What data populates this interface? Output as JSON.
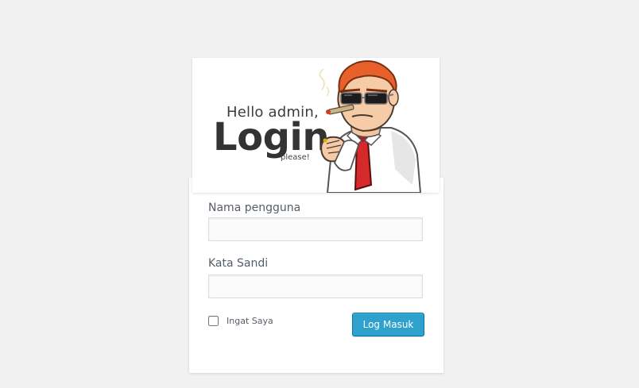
{
  "logo": {
    "hello_text": "Hello admin,",
    "login_text": "Login",
    "please_text": "please!",
    "mascot_icon": "mascot-bouncer-icon"
  },
  "form": {
    "username_label": "Nama pengguna",
    "username_value": "",
    "password_label": "Kata Sandi",
    "password_value": "",
    "remember_label": "Ingat Saya",
    "remember_checked": false,
    "submit_label": "Log Masuk"
  },
  "colors": {
    "background": "#f1f1f1",
    "card": "#ffffff",
    "button": "#2ea2cc",
    "button_border": "#0074a2",
    "mascot_hair": "#e8612c",
    "mascot_tie": "#d62a2a"
  }
}
